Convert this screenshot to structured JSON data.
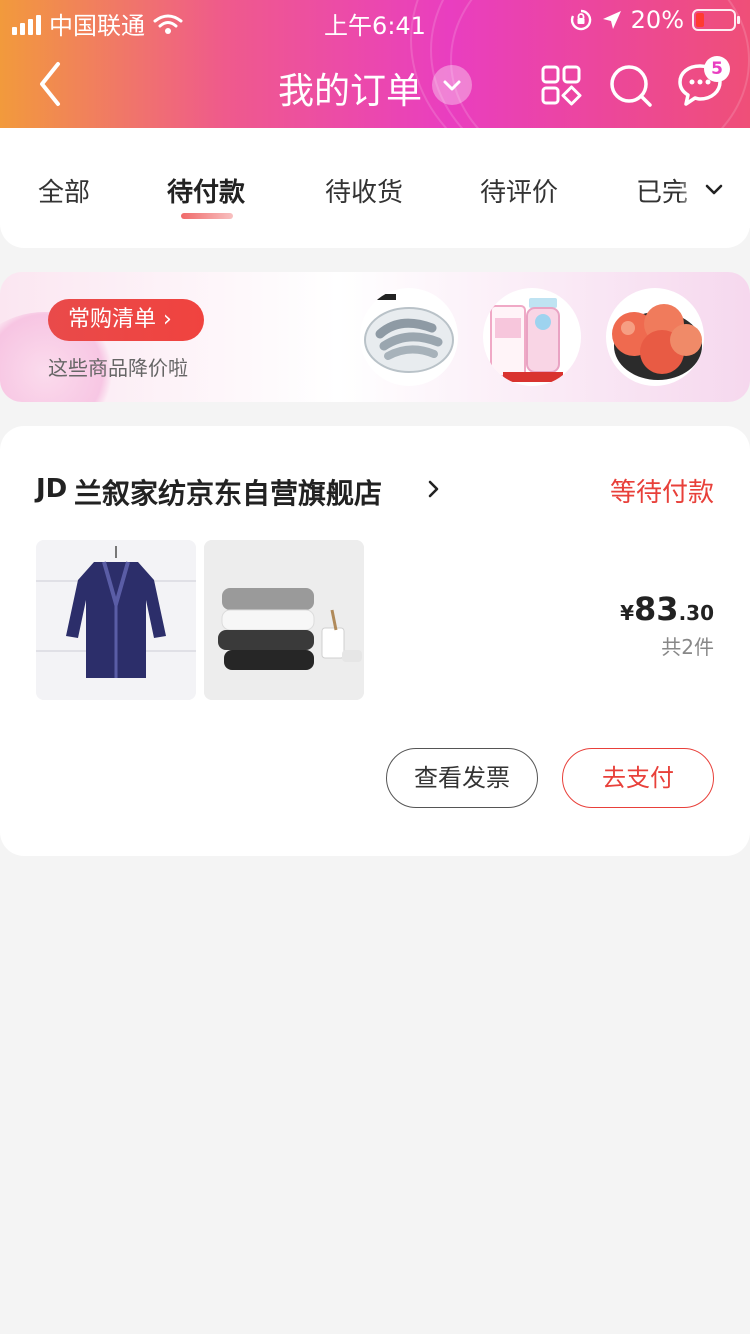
{
  "status_bar": {
    "carrier": "中国联通",
    "time": "上午6:41",
    "battery": "20%"
  },
  "nav": {
    "title": "我的订单",
    "message_badge": "5"
  },
  "tabs": {
    "items": [
      {
        "label": "全部"
      },
      {
        "label": "待付款"
      },
      {
        "label": "待收货"
      },
      {
        "label": "待评价"
      },
      {
        "label": "已完"
      }
    ],
    "active_index": 1
  },
  "banner": {
    "pill_label": "常购清单 ›",
    "subtitle": "这些商品降价啦"
  },
  "order": {
    "shop_logo": "JD",
    "shop_name": "兰叙家纺京东自营旗舰店",
    "status": "等待付款",
    "price_symbol": "¥",
    "price_int": "83",
    "price_dec": ".30",
    "quantity": "共2件",
    "btn_invoice": "查看发票",
    "btn_pay": "去支付"
  },
  "colors": {
    "accent_red": "#e8403a",
    "header_gradient_start": "#f29a3c",
    "header_gradient_mid": "#e93ec0"
  }
}
